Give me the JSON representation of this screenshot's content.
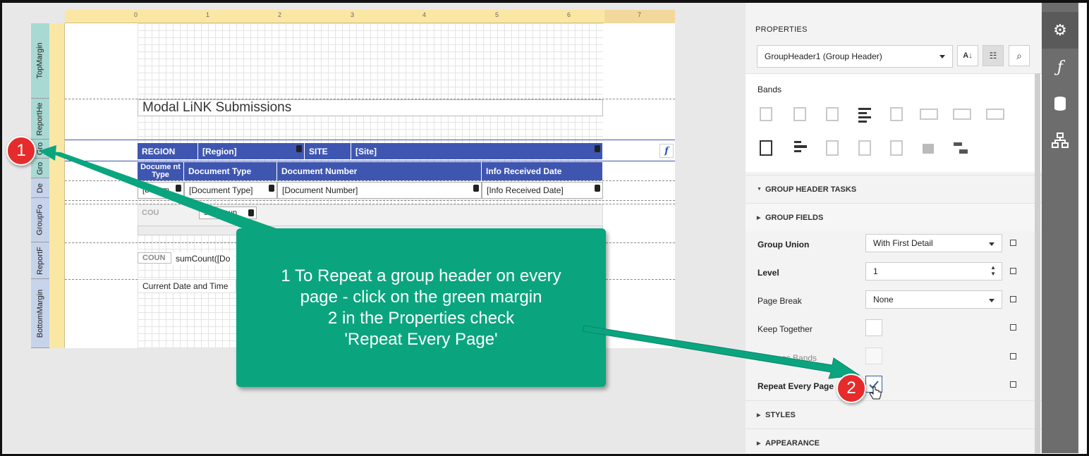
{
  "designer": {
    "ruler_ticks": [
      "0",
      "1",
      "2",
      "3",
      "4",
      "5",
      "6",
      "7"
    ],
    "band_labels": [
      "TopMargin",
      "ReportHe",
      "Gro",
      "Gro",
      "De",
      "GroupFo",
      "ReportF",
      "BottomMargin"
    ],
    "report_title": "Modal LiNK Submissions",
    "group_header_1": [
      "REGION",
      "[Region]",
      "SITE",
      "[Site]"
    ],
    "group_header_2": [
      "Docume nt Type",
      "Document Type",
      "Document Number",
      "Info Received Date"
    ],
    "detail": [
      "[Docum",
      "[Document Type]",
      "[Document Number]",
      "[Info Received Date]"
    ],
    "group_footer": [
      "COU",
      "sumCoun"
    ],
    "report_footer": [
      "COUN",
      "sumCount([Do"
    ],
    "bottom": "Current Date and Time",
    "fx_icon": "f"
  },
  "callout": {
    "lines": [
      "1 To Repeat a group header on every",
      "page - click on the green margin",
      "2  in the Properties  check",
      "'Repeat Every Page'"
    ]
  },
  "badges": {
    "one": "1",
    "two": "2"
  },
  "properties": {
    "title": "PROPERTIES",
    "selected_component": "GroupHeader1 (Group Header)",
    "bands_label": "Bands",
    "sections": {
      "group_header_tasks": "GROUP HEADER TASKS",
      "group_fields": "GROUP FIELDS",
      "styles": "STYLES",
      "appearance": "APPEARANCE"
    },
    "rows": [
      {
        "label": "Group Union",
        "value": "With First Detail",
        "kind": "select"
      },
      {
        "label": "Level",
        "value": "1",
        "kind": "spin"
      },
      {
        "label": "Page Break",
        "value": "None",
        "kind": "select"
      },
      {
        "label": "Keep Together",
        "value": "",
        "kind": "check"
      },
      {
        "label": "...Across Bands",
        "value": "",
        "kind": "check"
      },
      {
        "label": "Repeat Every Page",
        "value": "checked",
        "kind": "check"
      }
    ]
  },
  "sidebar": {
    "icons": [
      "gear-icon",
      "function-icon",
      "database-icon",
      "hierarchy-icon"
    ],
    "active_color": "#5a5a5a"
  },
  "colors": {
    "accent": "#3f56b0",
    "callout": "#0aa57f",
    "badge": "#e52b2b"
  }
}
